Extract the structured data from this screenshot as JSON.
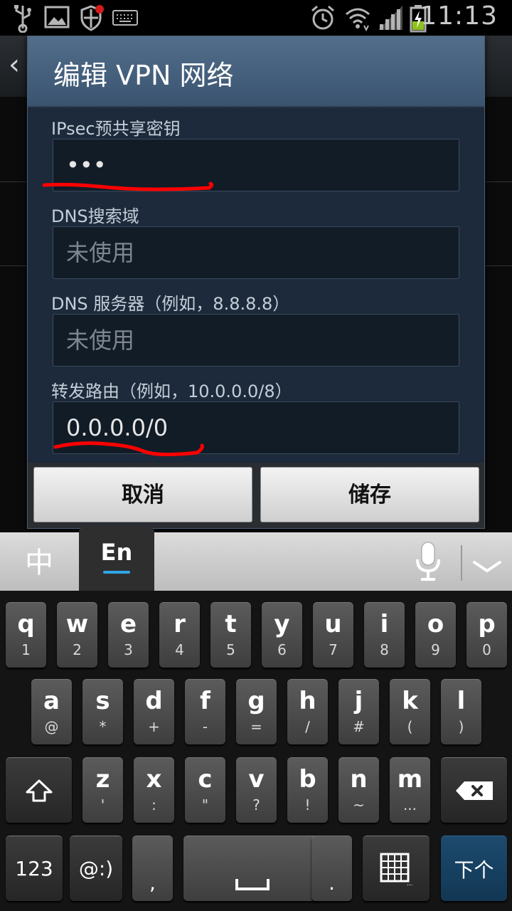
{
  "status_bar": {
    "time": "11:13"
  },
  "dialog": {
    "title": "编辑 VPN 网络",
    "fields": [
      {
        "label": "IPsec预共享密钥",
        "value": "•••",
        "is_placeholder": false
      },
      {
        "label": "DNS搜索域",
        "value": "未使用",
        "is_placeholder": true
      },
      {
        "label": "DNS 服务器（例如，8.8.8.8）",
        "value": "未使用",
        "is_placeholder": true
      },
      {
        "label": "转发路由（例如，10.0.0.0/8）",
        "value": "0.0.0.0/0",
        "is_placeholder": false
      }
    ],
    "cancel_label": "取消",
    "save_label": "储存"
  },
  "keyboard": {
    "tab_chinese": "中",
    "tab_english": "En",
    "row1": [
      {
        "main": "q",
        "sub": "1"
      },
      {
        "main": "w",
        "sub": "2"
      },
      {
        "main": "e",
        "sub": "3"
      },
      {
        "main": "r",
        "sub": "4"
      },
      {
        "main": "t",
        "sub": "5"
      },
      {
        "main": "y",
        "sub": "6"
      },
      {
        "main": "u",
        "sub": "7"
      },
      {
        "main": "i",
        "sub": "8"
      },
      {
        "main": "o",
        "sub": "9"
      },
      {
        "main": "p",
        "sub": "0"
      }
    ],
    "row2": [
      {
        "main": "a",
        "sub": "@"
      },
      {
        "main": "s",
        "sub": "*"
      },
      {
        "main": "d",
        "sub": "+"
      },
      {
        "main": "f",
        "sub": "-"
      },
      {
        "main": "g",
        "sub": "="
      },
      {
        "main": "h",
        "sub": "/"
      },
      {
        "main": "j",
        "sub": "#"
      },
      {
        "main": "k",
        "sub": "("
      },
      {
        "main": "l",
        "sub": ")"
      }
    ],
    "row3": [
      {
        "main": "z",
        "sub": "'"
      },
      {
        "main": "x",
        "sub": ":"
      },
      {
        "main": "c",
        "sub": "\""
      },
      {
        "main": "v",
        "sub": "?"
      },
      {
        "main": "b",
        "sub": "!"
      },
      {
        "main": "n",
        "sub": "~"
      },
      {
        "main": "m",
        "sub": "..."
      }
    ],
    "key_123": "123",
    "key_emoticon": "@:)",
    "key_comma": ",",
    "key_period": ".",
    "key_next": "下个"
  },
  "colors": {
    "dialog_header": "#3a5470",
    "dialog_body": "#1c2a3b",
    "annotation": "#ff0000",
    "keyboard_accent": "#2fa6e8"
  }
}
